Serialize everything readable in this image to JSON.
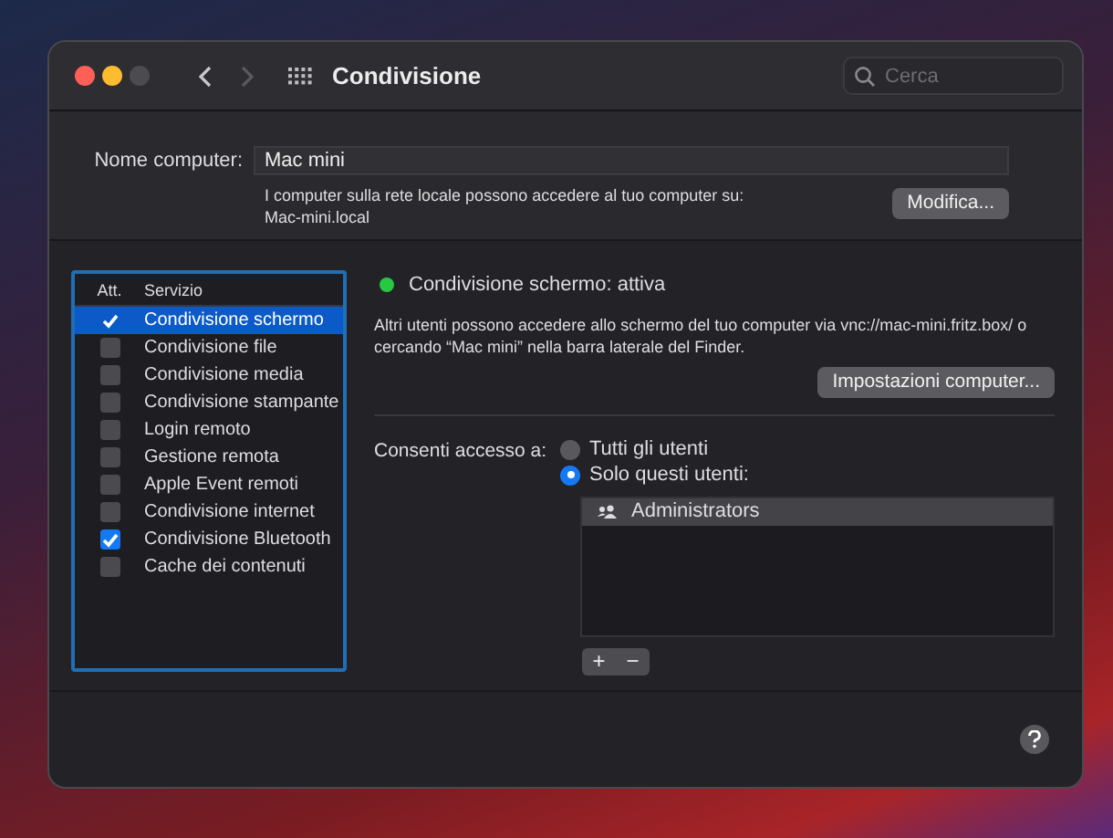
{
  "window": {
    "title": "Condivisione"
  },
  "navigation": [
    {
      "kind": "back",
      "disabled": false
    },
    {
      "kind": "forward",
      "disabled": true
    }
  ],
  "search": {
    "placeholder": "Cerca"
  },
  "computer_name": {
    "label": "Nome computer:",
    "value": "Mac mini",
    "info": "I computer sulla rete locale possono accedere al tuo computer su:",
    "hostname": "Mac-mini.local",
    "button": "Modifica..."
  },
  "services": {
    "columns": [
      "Att.",
      "Servizio"
    ],
    "rows": [
      {
        "name": "Condivisione schermo",
        "checked": true,
        "selected": true
      },
      {
        "name": "Condivisione file",
        "checked": false,
        "selected": false
      },
      {
        "name": "Condivisione media",
        "checked": false,
        "selected": false
      },
      {
        "name": "Condivisione stampante",
        "checked": false,
        "selected": false
      },
      {
        "name": "Login remoto",
        "checked": false,
        "selected": false
      },
      {
        "name": "Gestione remota",
        "checked": false,
        "selected": false
      },
      {
        "name": "Apple Event remoti",
        "checked": false,
        "selected": false
      },
      {
        "name": "Condivisione internet",
        "checked": false,
        "selected": false
      },
      {
        "name": "Condivisione Bluetooth",
        "checked": true,
        "selected": false
      },
      {
        "name": "Cache dei contenuti",
        "checked": false,
        "selected": false
      }
    ]
  },
  "status": {
    "text": "Condivisione schermo: attiva",
    "active": true
  },
  "description": "Altri utenti possono accedere allo schermo del tuo computer via vnc://mac-mini.fritz.box/ o cercando “Mac mini” nella barra laterale del Finder.",
  "settings_button": "Impostazioni computer...",
  "access": {
    "label": "Consenti accesso a:",
    "options": [
      {
        "label": "Tutti gli utenti",
        "selected": false
      },
      {
        "label": "Solo questi utenti:",
        "selected": true
      }
    ],
    "users": [
      {
        "name": "Administrators",
        "selected": true
      }
    ],
    "buttons": [
      "+",
      "−"
    ]
  }
}
